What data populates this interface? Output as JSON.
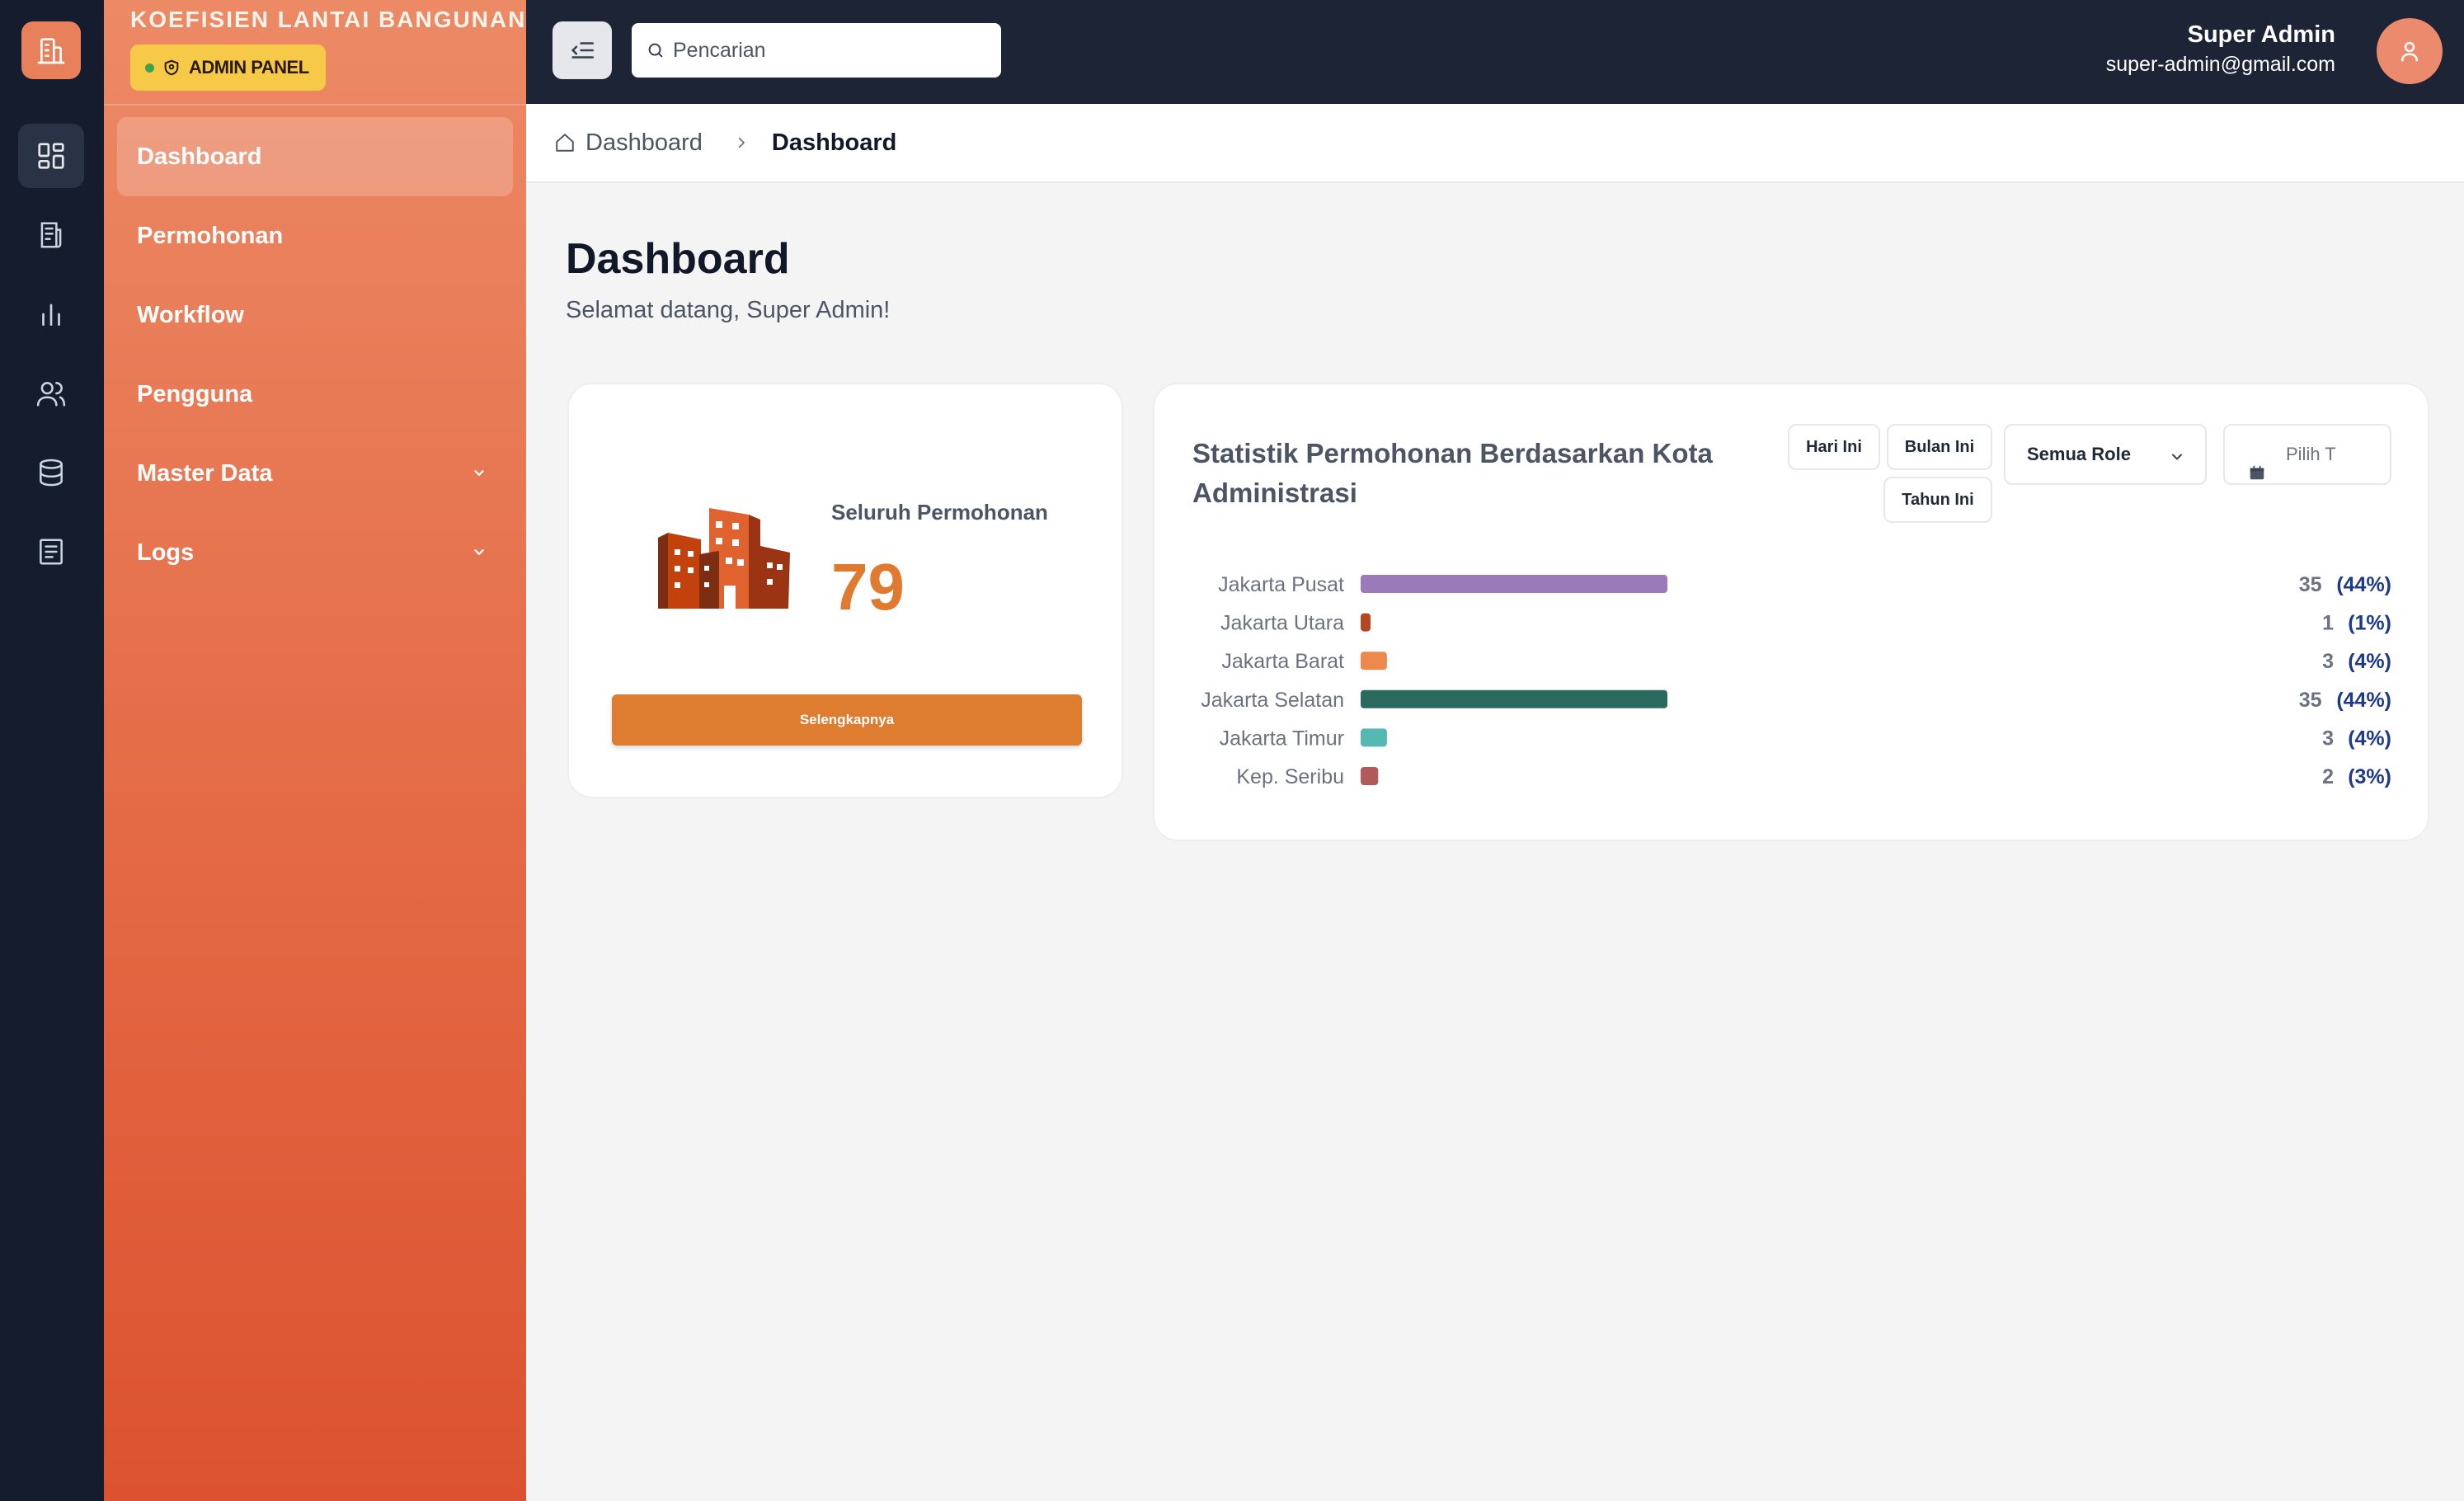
{
  "app": {
    "title": "KOEFISIEN LANTAI BANGUNAN",
    "badge": "ADMIN PANEL"
  },
  "rail": {
    "items": [
      "dashboard-icon",
      "document-icon",
      "bar-chart-icon",
      "users-icon",
      "database-icon",
      "logs-icon"
    ]
  },
  "sidebar": {
    "items": [
      {
        "label": "Dashboard",
        "active": true
      },
      {
        "label": "Permohonan"
      },
      {
        "label": "Workflow"
      },
      {
        "label": "Pengguna"
      },
      {
        "label": "Master Data",
        "expandable": true
      },
      {
        "label": "Logs",
        "expandable": true
      }
    ]
  },
  "header": {
    "search_placeholder": "Pencarian",
    "user_name": "Super Admin",
    "user_email": "super-admin@gmail.com"
  },
  "breadcrumb": {
    "home": "Dashboard",
    "current": "Dashboard"
  },
  "main": {
    "title": "Dashboard",
    "subtitle": "Selamat datang, Super Admin!"
  },
  "stat_card": {
    "label": "Seluruh Permohonan",
    "value": "79",
    "button": "Selengkapnya"
  },
  "chart_card": {
    "title": "Statistik Permohonan Berdasarkan Kota Administrasi",
    "filters": {
      "today": "Hari Ini",
      "month": "Bulan Ini",
      "year": "Tahun Ini",
      "role": "Semua Role",
      "date_placeholder": "Pilih T"
    }
  },
  "colors": {
    "accent": "#e07a2e",
    "sidebar_top": "#ec8a66",
    "sidebar_bottom": "#dc5230",
    "rail_bg": "#141c2e",
    "topbar_bg": "#1c2436",
    "percent_text": "#1e3a8a"
  },
  "chart_data": {
    "type": "bar",
    "orientation": "horizontal",
    "categories": [
      "Jakarta Pusat",
      "Jakarta Utara",
      "Jakarta Barat",
      "Jakarta Selatan",
      "Jakarta Timur",
      "Kep. Seribu"
    ],
    "values": [
      35,
      1,
      3,
      35,
      3,
      2
    ],
    "percent_labels": [
      "(44%)",
      "(1%)",
      "(4%)",
      "(44%)",
      "(4%)",
      "(3%)"
    ],
    "bar_colors": [
      "#9a7ab8",
      "#b3471f",
      "#ec8a4e",
      "#2a6a5e",
      "#55b8b3",
      "#b15a5a"
    ],
    "xlim": [
      0,
      35
    ]
  }
}
